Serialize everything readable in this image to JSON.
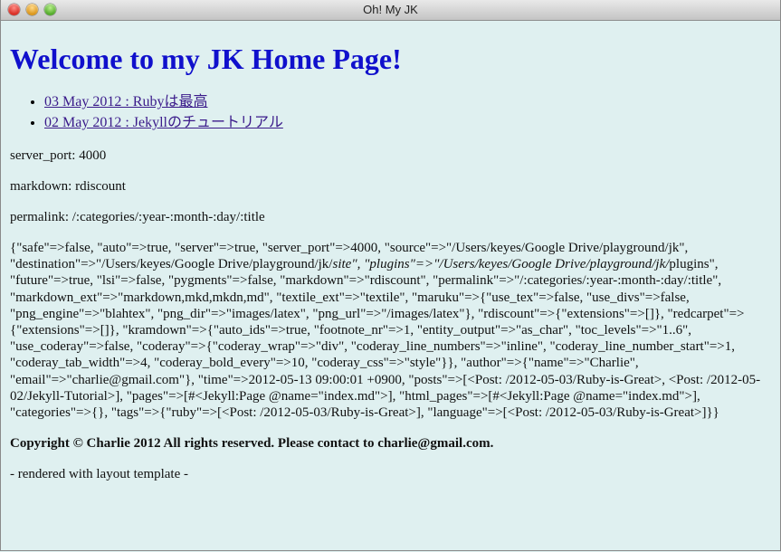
{
  "window": {
    "title": "Oh! My JK"
  },
  "page": {
    "heading": "Welcome to my JK Home Page!",
    "posts": [
      {
        "label": "03 May 2012 : Rubyは最高"
      },
      {
        "label": "02 May 2012 : Jekyllのチュートリアル"
      }
    ],
    "server_port": "server_port: 4000",
    "markdown": "markdown: rdiscount",
    "permalink": "permalink: /:categories/:year-:month-:day/:title",
    "config_dump_1": "{\"safe\"=>false, \"auto\"=>true, \"server\"=>true, \"server_port\"=>4000, \"source\"=>\"/Users/keyes/Google Drive/playground/jk\", \"destination\"=>\"/Users/keyes/Google Drive/playground/jk/",
    "config_dump_italic": "site\", \"plugins\"=>\"/Users/keyes/Google Drive/playground/jk/",
    "config_dump_2": "plugins\", \"future\"=>true, \"lsi\"=>false, \"pygments\"=>false, \"markdown\"=>\"rdiscount\", \"permalink\"=>\"/:categories/:year-:month-:day/:title\", \"markdown_ext\"=>\"markdown,mkd,mkdn,md\", \"textile_ext\"=>\"textile\", \"maruku\"=>{\"use_tex\"=>false, \"use_divs\"=>false, \"png_engine\"=>\"blahtex\", \"png_dir\"=>\"images/latex\", \"png_url\"=>\"/images/latex\"}, \"rdiscount\"=>{\"extensions\"=>[]}, \"redcarpet\"=>{\"extensions\"=>[]}, \"kramdown\"=>{\"auto_ids\"=>true, \"footnote_nr\"=>1, \"entity_output\"=>\"as_char\", \"toc_levels\"=>\"1..6\", \"use_coderay\"=>false, \"coderay\"=>{\"coderay_wrap\"=>\"div\", \"coderay_line_numbers\"=>\"inline\", \"coderay_line_number_start\"=>1, \"coderay_tab_width\"=>4, \"coderay_bold_every\"=>10, \"coderay_css\"=>\"style\"}}, \"author\"=>{\"name\"=>\"Charlie\", \"email\"=>\"charlie@gmail.com\"}, \"time\"=>2012-05-13 09:00:01 +0900, \"posts\"=>[<Post: /2012-05-03/Ruby-is-Great>, <Post: /2012-05-02/Jekyll-Tutorial>], \"pages\"=>[#<Jekyll:Page @name=\"index.md\">], \"html_pages\"=>[#<Jekyll:Page @name=\"index.md\">], \"categories\"=>{}, \"tags\"=>{\"ruby\"=>[<Post: /2012-05-03/Ruby-is-Great>], \"language\"=>[<Post: /2012-05-03/Ruby-is-Great>]}}",
    "copyright": "Copyright © Charlie 2012 All rights reserved. Please contact to charlie@gmail.com.",
    "rendered": "- rendered with layout template -"
  },
  "colors": {
    "background": "#dff0f0",
    "heading": "#1010cc",
    "link": "#3a1a8a"
  }
}
